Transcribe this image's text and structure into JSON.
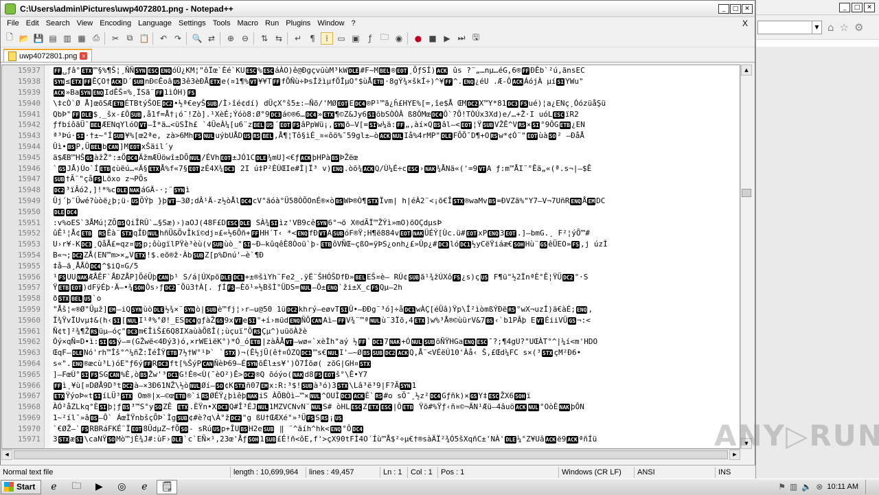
{
  "window": {
    "title": "C:\\Users\\admin\\Pictures\\uwp4072801.png - Notepad++",
    "min": "_",
    "max": "□",
    "close": "✕"
  },
  "menu": {
    "items": [
      "File",
      "Edit",
      "Search",
      "View",
      "Encoding",
      "Language",
      "Settings",
      "Tools",
      "Macro",
      "Run",
      "Plugins",
      "Window",
      "?"
    ],
    "close_doc": "X"
  },
  "tab": {
    "label": "uwp4072801.png",
    "close": "x"
  },
  "editor": {
    "lines": [
      {
        "n": "15937",
        "t": "FF␣ƒâ°ETX™§%¶Š¦¸ÑÑSYNESCENQóÙ¿KM¦\"ôÏœ`Èé`KUESC%ESCáÀO)ê@ĐgçvŭùM³kWDLE#F~MBEL®EOT¸ÕƒSÍ)ACK  ûs ?¨„…nµ…éG,6®FFĐÊb`²ú,ãnsEC"
      },
      {
        "n": "15938",
        "t": "SYN≤ETXFFÊÇO†ACKD´SUBnĐ©ÊoâUS3ê3èÐÅETXe(¤1¶%VT¥¥TFFfÕÑù÷ÞsÍžìµfÖÎµO°$ùÅETB·8gÝ¾×škÍ÷)^¥FF^.ENQ¿éU .Æ-ÔACKÁójÀ µíSIYWu\""
      },
      {
        "n": "15939",
        "t": "ACK»BaSYNENQIdÊŠ¤%¸ÏSã¨FF1ìÓH)FS"
      },
      {
        "n": "15940",
        "t": "\\‡cÒ`Ø Å]œõSÆETBÉTBtýŠOEDC2•½ª€eyŠSUB/Ì›îé¢dí)  dÜçX°ŝ5±:–Ñõ/'MØEOTEDC4®P¹™ã¿ĥ£HYE%[=,îe$Å ŒMDC2X™Y*81DC3FSué)¦a¿ENç¸ÓózüåŞü"
      },
      {
        "n": "15941",
        "t": "QbÞ\"FFDLE$¸_šx-£ÔSUB,å1f=Å†¡ó¯!Zò].¹XèÉ;Ýóò8:Ø°9DC3á©®6…DC4»ETX¶©Z&Jy6SIõbSÒÒÂ     ß8ÔMœDC4Ô`?Õ!TÒÚx3Xd)e/…+Ž·I     uóLESCïR2"
      },
      {
        "n": "15942",
        "t": "ƒfbíôãÜ¯BELÆENqYlóOVT–Ì*ä…<üSÌh£    `4ÜeÀ¼[u6¨zBELUS´EOTFSâPpWü¡,SYNõ–V[=SIw¼ä:FF„,àí×QBSâl–<EOT¦ŸSUBVŽÊ^VRS×SI°9ÔGETB¿EN"
      },
      {
        "n": "15943",
        "t": "ª³Þú·SI·†±~°ÍSUB¥%[œ2ªe,  zà>6MhFSNULuýbUÅDUSRSBEL,Å¶¦Tô§ìÉ_¤«ôö%¯59gl±—òACKNULIå%4rMP\"DLEFÕÕ¯D¶+ORSw*¢Ó¨\"EOTùàSO² –ĐåÅ"
      },
      {
        "n": "15944",
        "t": "Ûì•BSP,ÜBELbCAN]MEOTxŠäil´y"
      },
      {
        "n": "15945",
        "t": "ä$ÆB™HŠGSàžŽ°:±ÕDC4ÄžmÆÜöwî±DÕNUL/ÉVhEOT±JÓ1CDLE¾mU]<€ƒACKþHPàBSÞŽëœ"
      },
      {
        "n": "15946",
        "t": "`GSJÅ)Ùo`ÍETB¢ùëú…«Ä§ETXÅ%f«7§EOTzÉ4X¾DC3 2I ú‡P²ÈÙŒIe#Ì|Ï³ v)ENQ.òõ¾ACKQ/Ù¼É÷cESC›NAK¾ÅNä«('=9VTA   ƒ:m™ÅI¨°Êä„«(ª.s¬|–$Ê"
      },
      {
        "n": "15947",
        "t": "SUB†Ã¨\"çåFSLõxo     z¬PÕs"
      },
      {
        "n": "15948",
        "t": "DC2³ïÂó2,]!*%cDLENAKáGÄ-·;¨SYNì"
      },
      {
        "n": "15949",
        "t": "Ûj´þ¨Üwé?ùòë¿þ;ü-USÖÝþ  }þVT–3Ø;dÂ¹Ä-z½òÅlDC4cV\"ãóà°Ü58ÒÕOnÉ®×òBSWÞ®Ò¶STXÏvm|  h|éÀ2¨<¡õ€ÎSTX®waMvBS=ĐVZã%\"Y7–V¬7UñRENQÅEMDC"
      },
      {
        "n": "15950",
        "t": "DLEDC4"
      },
      {
        "n": "15951",
        "t": ":v%oES`3ÅMú¦ZÕBSQiÎRÛ`…§Sæ)›)aOJ(48F£DESCDLE  SÀ¾SIìz'VB9cêSYN6°¬ö  X®dÃÏ™ŽÝì»mO)õOÇdµsÞ"
      },
      {
        "n": "15952",
        "t": "ûÊ¹¦Å¢ETB   RSÊà¨STXqÎÐNULhñÜ&ÕvÎkï©dj¤£«½6Õñ+FFHH´T‹ *<ENQfÐVTASUBóF®Ÿ;H¶ë884vEOTNAKÜÉÝ[Ùc.ü#EOTxPENQ3EOT.]–bmG.¸ F²¦ýÕ™#"
      },
      {
        "n": "15953",
        "t": "U›r¥-KDC3¸QåÅ£=qz¤USp;ôùgïlPŸè³èù(vSUBùò_\"SI~Ð–kûqêÈ8Òoü`þ-ETBôVÑŒ~çßO=ÿÞS¿onh¿£»Ûp¿#DC3lóDC1½yCëŸiáæ€SOHHù¨GSêÜEO»FS,j  úzÌ"
      },
      {
        "n": "15954",
        "t": "B«¬;DC2ZÅ(EN™m>×„VETX!$.eõ®ž·ÀbSUBZ[p%Dnú'–è`¶Ð"
      },
      {
        "n": "15955",
        "t": "‡å–ã¸ÅÅÓDC4^$iQ¤G/5"
      },
      {
        "n": "15956",
        "t": "¹FSUUNAKÆÅÊF`ÅÐZÅP]ÕéÜþCANþ¹    S/á|ÚXpõDLEDC1+±®šìYh¨Fe2_.ÿË¨ŠHÓŠDfÐ»BELEŠ¤è–  RÚ¢SUBã¹¾žÚXôFS¿s)çUS  F¶ü\"½2ÏnªÈ°Ê¦ŸÜDC2°·S"
      },
      {
        "n": "15957",
        "t": "ŸETBEOT)dFÿÉþ·Ä–•¾SOHÔs›ƒDC2¯Õü3†À[.  ƒÍFS–Èõ¹»½BšÌ°ÜDS=NUL–Ô±ENQ`ži±X_cFSQµ–2h"
      },
      {
        "n": "15958",
        "t": "ðSTXBELUS`o"
      },
      {
        "n": "15959",
        "t": "\"Åš¦«®Ø\"Üµž]EM–iQSYNùòDLE½¾×¨SYNò|SUBè™fj¦›r–u@50 1üDC2khrý–eøvTSIÛ•–ÐÐg¨³ó]÷åDC1wÀÇ[éÜâ)Ÿp\\Î²ìòmßÝÐëRS°wX¬uzÍ)ä€àÉ;ENQ,"
      },
      {
        "n": "15960",
        "t": "Ï¾ŸvÏUvµ‡&(h‹SI[NULI¹ª%°Ø!_ESDC4gƒàŽGS9xVTeSI°+í›müdENQÑÕCANAì–FFV¾¨™ªNULù¨3Ïõ,4ETX]w%³Å®©ùürV&7BS‹`b1PÂþ EVTÉiiVÜGS¬:<"
      },
      {
        "n": "15961",
        "t": "Ñ¢t]²¾¶ŽRSüµ–óç\"DC3m€ÎìŠ£6Q8IXaùàÕßÎ(;ùçuï\"ÕRSÇµ^)uüöÀžè"
      },
      {
        "n": "15962",
        "t": "Óý×qÑ=D•ì:SIGSý–=(GŽwë<4Ðý3)ó,×rWEìëK°)*Ó_óETB|zàÂÅVT–wø«`xèÌh\"aý  ½FF`DC17NAK+ÓNULSUBõÑŸHGaENQESC¯?;¶4gU?\"UŒÀT°^|¼í<m'HDO"
      },
      {
        "n": "15963",
        "t": "ŒqF–DLENó'rh™Îš°^¼ñŽ:ÏéÎŸETB7½†W°¹Þ`  `STX)¬(Ê½jÜ(ê†¤ÓZQDC1™s€NULI'–~ØBSSUBDC2ACKQ,Å¨<VÉëÚ10'Àå‹  Š,£Œd¼FC    s×(³STXçM²Ð6•"
      },
      {
        "n": "15964",
        "t": "s«\".ENQ®æcù³L)óE\"ƒ6ýFFRDC3ft[%ŠýPCANÑèÞ69–ÉSYNõÉl±s¥')Ò7Íõø(     zõG|GH¤STX"
      },
      {
        "n": "15965",
        "t": "]–FœÙ°SIFSSGCAN%È,òBSŽw'³DC1G!É®<Ù(¯èO²)Ê>DC2®Q    õóýo(NAKd8FSEOTš°\\Ê•Y7"
      },
      {
        "n": "15966",
        "t": "FFì¸¥ù[¤DØÅ9D³tDC2à–×3Ð61NŽ\\½òNULØí–SO¢KSTXñ07EMx:R:³$!SUBà³ó)3STX\\Lâ³ë³9|F?ÃSYN1"
      },
      {
        "n": "15967",
        "t": "ETXŸýoÞ«tSIíLÜ³STX Om®|x–©œETB®`iRSØÉŸ¿þìêþNAKiS ÀÕBÒì–™×NUL^OUÌDC3ACKÈ`RS#o sÖ¯¸½z²DC4Gƒñk)×GSY‡ESCŽX6SOHï"
      },
      {
        "n": "15968",
        "t": "ÀÓ²åZLkq°ÈSIþ¦ƒBS³™S°ySOZÊ ETX.ÈŸn•XDC3Q#Î³ÉJNUL1MZVCNvN¨NULS# òHLESCZETXESC|ÔETB Ÿõ#%Ÿƒ‹ñ¤©¬ÄN¹Æü–4âuöACKNUL°OòÈNAKþÔN"
      },
      {
        "n": "15969",
        "t": "1~²íl¯»âBS–Ô`    ÁœÌŸnbšçÕÞ`ÌgSUB¢#è?q\\À°žDC2\"g ßU†ŒÆXé°»³ÜFSSRS¡US"
      },
      {
        "n": "15970",
        "t": "`€ØŽ–`FSRBRáFKÉ¨ÏEOT8ÜdµZ~fÕSO- sRúUSp+ÎUBSH2eSUB  ‖     ¨^ãíh^hk<ENQ°ÔDC4"
      },
      {
        "n": "15971",
        "t": "3STXæSI\\caNŸSOMò™jÈ¾J#:ùF›DLE`c`EÑ×¹,23œ'ÅƒSOH1SUB£É!ñ<ôE,f'>çX90tFÍ4O´Íù™Å$²÷µ€†®sàÄÏ²¾Ó5šXqñC±'NÀ'DLE¼°Z¥UâACKë9ACKªñÍü"
      }
    ],
    "control_codes": [
      "ETX",
      "SYN",
      "ESC",
      "ENQ",
      "ACK",
      "DLE",
      "BEL",
      "EOT",
      "DC1",
      "DC2",
      "DC3",
      "DC4",
      "STX",
      "SUB",
      "NUL",
      "NAK",
      "ETB",
      "CAN",
      "EM",
      "SOH",
      "SO",
      "SI",
      "VT",
      "FF",
      "FS",
      "GS",
      "RS",
      "US",
      "BS"
    ]
  },
  "status": {
    "type": "Normal text file",
    "length": "length : 10,699,964",
    "lines": "lines : 49,457",
    "ln": "Ln : 1",
    "col": "Col : 1",
    "pos": "Pos : 1",
    "eol": "Windows (CR LF)",
    "encoding": "ANSI",
    "mode": "INS"
  },
  "watermark": "ANY▷RUN",
  "taskbar": {
    "start": "Start",
    "time": "10:11 AM"
  }
}
